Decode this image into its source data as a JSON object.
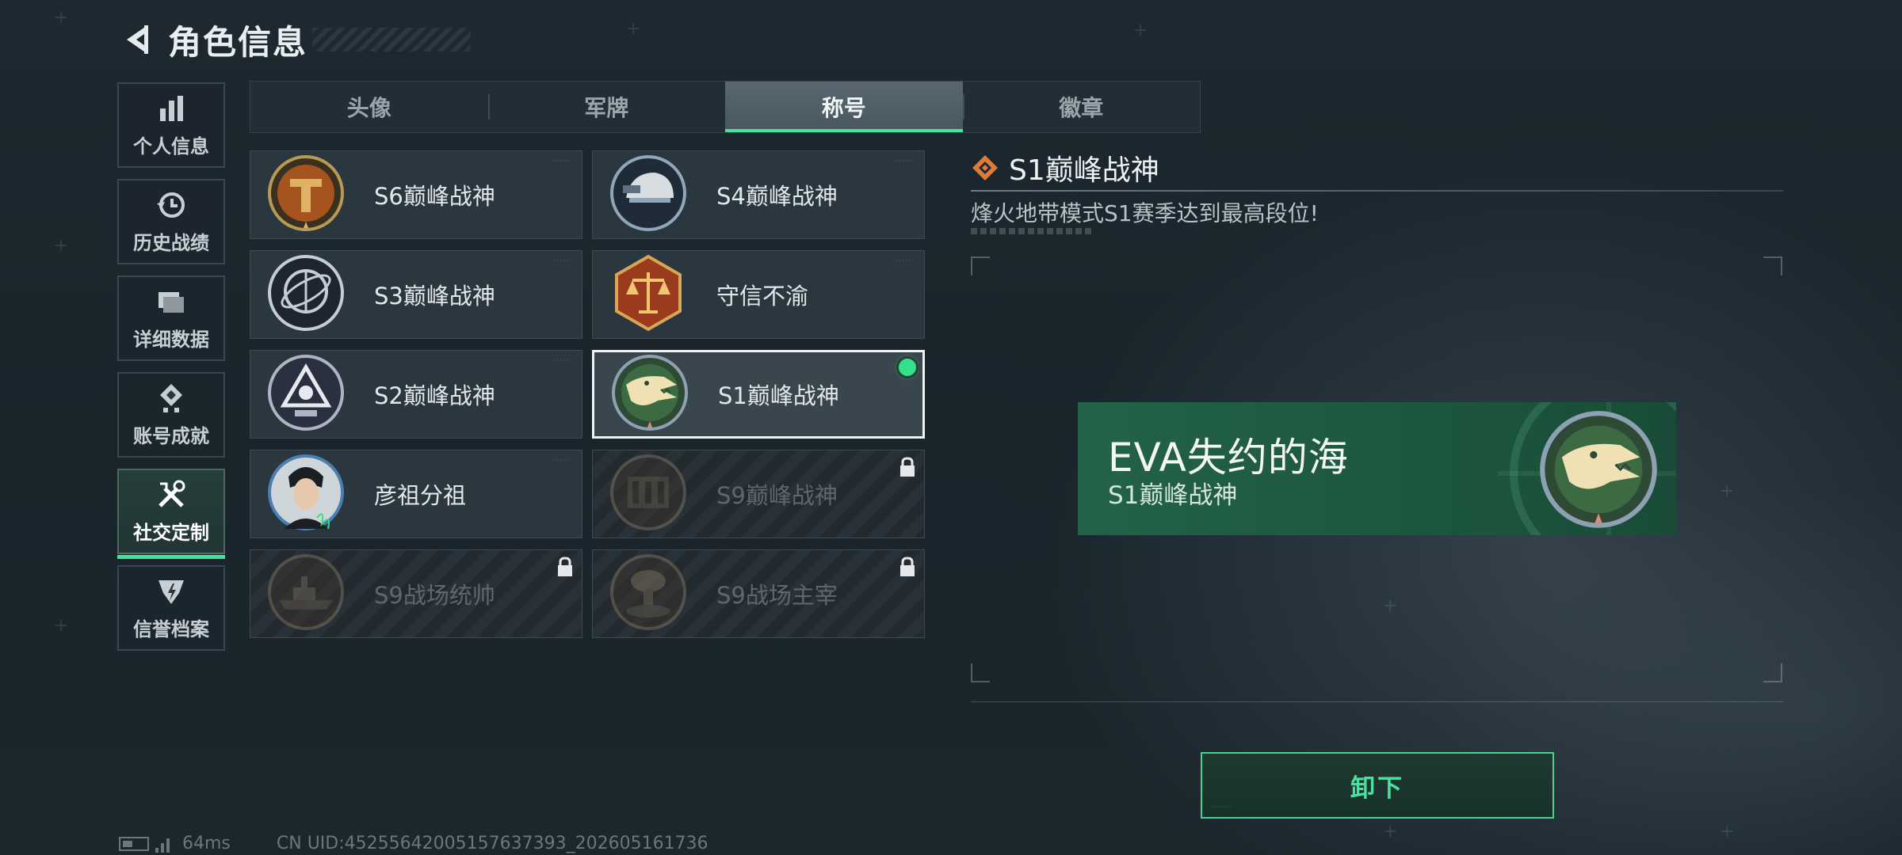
{
  "header": {
    "title": "角色信息"
  },
  "sidebar": {
    "items": [
      {
        "label": "个人信息",
        "icon": "bar-chart-icon",
        "active": false
      },
      {
        "label": "历史战绩",
        "icon": "history-icon",
        "active": false
      },
      {
        "label": "详细数据",
        "icon": "folder-icon",
        "active": false
      },
      {
        "label": "账号成就",
        "icon": "achievement-icon",
        "active": false
      },
      {
        "label": "社交定制",
        "icon": "tools-icon",
        "active": true
      },
      {
        "label": "信誉档案",
        "icon": "credit-icon",
        "active": false
      }
    ]
  },
  "tabs": [
    {
      "label": "头像",
      "active": false
    },
    {
      "label": "军牌",
      "active": false
    },
    {
      "label": "称号",
      "active": true
    },
    {
      "label": "徽章",
      "active": false
    }
  ],
  "titles": [
    {
      "label": "S6巅峰战神",
      "icon": "s6-emblem-icon",
      "locked": false,
      "selected": false
    },
    {
      "label": "S4巅峰战神",
      "icon": "s4-emblem-icon",
      "locked": false,
      "selected": false
    },
    {
      "label": "S3巅峰战神",
      "icon": "s3-emblem-icon",
      "locked": false,
      "selected": false
    },
    {
      "label": "守信不渝",
      "icon": "scales-emblem-icon",
      "locked": false,
      "selected": false
    },
    {
      "label": "S2巅峰战神",
      "icon": "s2-emblem-icon",
      "locked": false,
      "selected": false
    },
    {
      "label": "S1巅峰战神",
      "icon": "crocodile-emblem-icon",
      "locked": false,
      "selected": true,
      "equipped": true
    },
    {
      "label": "彦祖分祖",
      "icon": "portrait-emblem-icon",
      "locked": false,
      "selected": false
    },
    {
      "label": "S9巅峰战神",
      "icon": "s9-emblem-icon",
      "locked": true,
      "selected": false
    },
    {
      "label": "S9战场统帅",
      "icon": "warship-emblem-icon",
      "locked": true,
      "selected": false
    },
    {
      "label": "S9战场主宰",
      "icon": "explosion-emblem-icon",
      "locked": true,
      "selected": false
    }
  ],
  "detail": {
    "title": "S1巅峰战神",
    "description": "烽火地带模式S1赛季达到最高段位!",
    "preview": {
      "player_name": "EVA失约的海",
      "title": "S1巅峰战神"
    }
  },
  "actions": {
    "unequip_label": "卸下"
  },
  "footer": {
    "ping": "64ms",
    "uid": "CN UID:45255642005157637393_202605161736"
  },
  "colors": {
    "accent": "#45e3a0",
    "preview_bg": "#1d573f",
    "equipped_dot": "#34e08a"
  }
}
